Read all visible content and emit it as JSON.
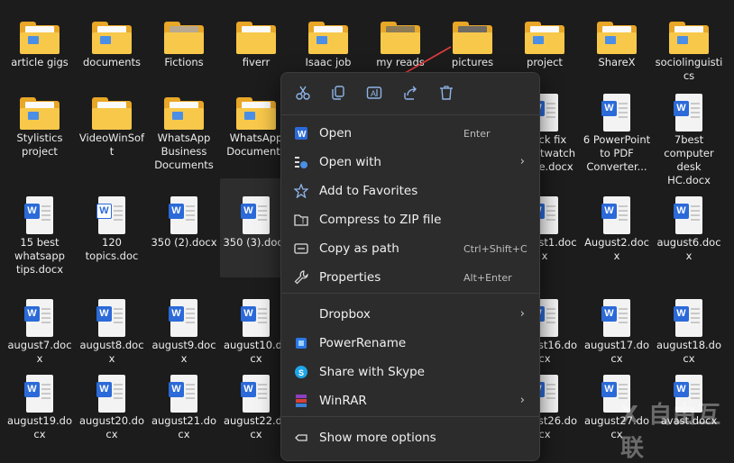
{
  "files": {
    "row1": [
      {
        "label": "article gigs",
        "type": "folder"
      },
      {
        "label": "documents",
        "type": "folder"
      },
      {
        "label": "Fictions",
        "type": "folder-img"
      },
      {
        "label": "fiverr",
        "type": "folder"
      },
      {
        "label": "Isaac job",
        "type": "folder"
      },
      {
        "label": "my reads",
        "type": "folder-img"
      },
      {
        "label": "pictures",
        "type": "folder-img"
      },
      {
        "label": "project",
        "type": "folder"
      },
      {
        "label": "ShareX",
        "type": "folder"
      },
      {
        "label": "sociolinguistics",
        "type": "folder"
      }
    ],
    "row2": [
      {
        "label": "Stylistics project",
        "type": "folder"
      },
      {
        "label": "VideoWinSoft",
        "type": "folder"
      },
      {
        "label": "WhatsApp Business Documents",
        "type": "folder"
      },
      {
        "label": "WhatsApp Documents",
        "type": "folder"
      },
      {
        "label": "quick fix smartwatch guide.docx",
        "type": "doc"
      },
      {
        "label": "6 PowerPoint to PDF Converter...",
        "type": "doc"
      },
      {
        "label": "7best computer desk HC.docx",
        "type": "doc"
      }
    ],
    "row3": [
      {
        "label": "15 best whatsapp tips.docx",
        "type": "doc"
      },
      {
        "label": "120 topics.doc",
        "type": "doc"
      },
      {
        "label": "350 (2).docx",
        "type": "doc"
      },
      {
        "label": "350 (3).docx",
        "type": "doc"
      },
      {
        "label": "august1.docx",
        "type": "doc"
      },
      {
        "label": "August2.docx",
        "type": "doc"
      },
      {
        "label": "august6.docx",
        "type": "doc"
      }
    ],
    "row4": [
      {
        "label": "august7.docx",
        "type": "doc"
      },
      {
        "label": "august8.docx",
        "type": "doc"
      },
      {
        "label": "august9.docx",
        "type": "doc"
      },
      {
        "label": "august10.docx",
        "type": "doc"
      },
      {
        "label": "august16.docx",
        "type": "doc"
      },
      {
        "label": "august17.docx",
        "type": "doc"
      },
      {
        "label": "august18.docx",
        "type": "doc"
      }
    ],
    "row5": [
      {
        "label": "august19.docx",
        "type": "doc"
      },
      {
        "label": "august20.docx",
        "type": "doc"
      },
      {
        "label": "august21.docx",
        "type": "doc"
      },
      {
        "label": "august22.docx",
        "type": "doc"
      },
      {
        "label": "august26.docx",
        "type": "doc"
      },
      {
        "label": "august27.docx",
        "type": "doc"
      },
      {
        "label": "avast.docx",
        "type": "doc"
      }
    ]
  },
  "menu": {
    "toolbar": [
      "cut-icon",
      "copy-icon",
      "rename-icon",
      "share-icon",
      "delete-icon"
    ],
    "items": [
      {
        "label": "Open",
        "shortcut": "Enter",
        "icon": "word-icon"
      },
      {
        "label": "Open with",
        "shortcut": "",
        "icon": "open-with-icon",
        "submenu": true
      },
      {
        "label": "Add to Favorites",
        "shortcut": "",
        "icon": "star-icon"
      },
      {
        "label": "Compress to ZIP file",
        "shortcut": "",
        "icon": "zip-icon"
      },
      {
        "label": "Copy as path",
        "shortcut": "Ctrl+Shift+C",
        "icon": "path-icon"
      },
      {
        "label": "Properties",
        "shortcut": "Alt+Enter",
        "icon": "wrench-icon"
      },
      {
        "label": "Dropbox",
        "shortcut": "",
        "icon": "",
        "submenu": true
      },
      {
        "label": "PowerRename",
        "shortcut": "",
        "icon": "powerrename-icon"
      },
      {
        "label": "Share with Skype",
        "shortcut": "",
        "icon": "skype-icon"
      },
      {
        "label": "WinRAR",
        "shortcut": "",
        "icon": "winrar-icon",
        "submenu": true
      },
      {
        "label": "Show more options",
        "shortcut": "",
        "icon": "more-options-icon"
      }
    ]
  },
  "colors": {
    "background": "#1c1c1c",
    "menu": "#2c2c2c",
    "accent": "#8fb4e8",
    "annotation": "#e03c3c"
  },
  "watermark": "X 自由互联"
}
